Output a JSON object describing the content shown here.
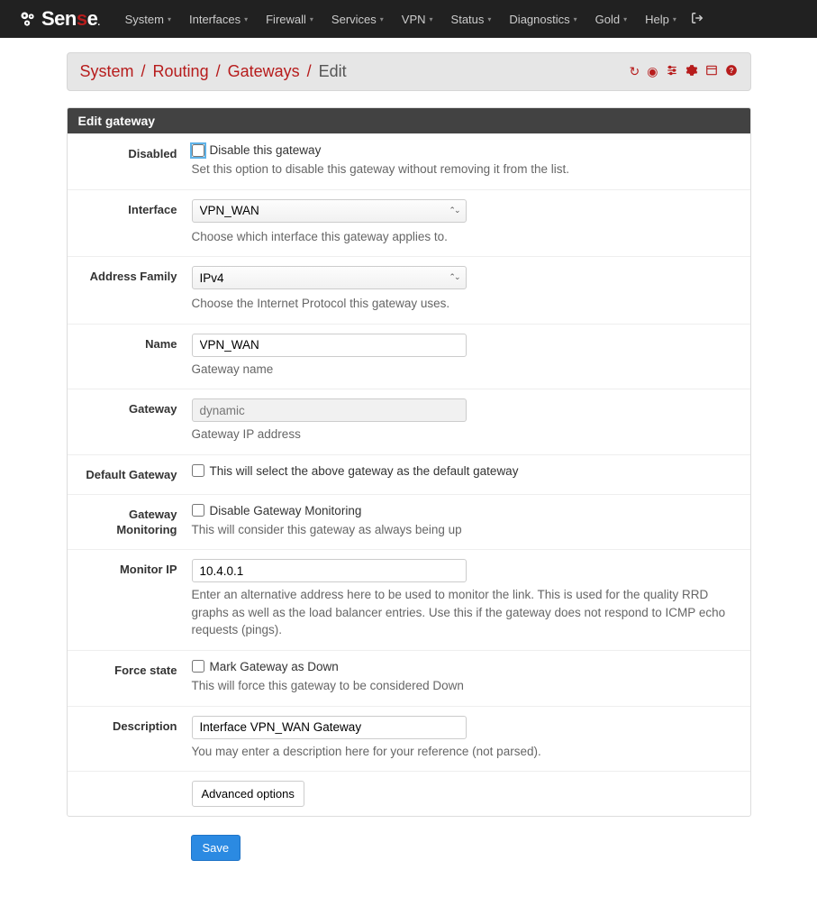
{
  "logo": {
    "text_sen": "Sen",
    "text_s": "s",
    "text_e": "e",
    "dot": "."
  },
  "nav": {
    "items": [
      "System",
      "Interfaces",
      "Firewall",
      "Services",
      "VPN",
      "Status",
      "Diagnostics",
      "Gold",
      "Help"
    ]
  },
  "breadcrumb": {
    "parts": [
      "System",
      "Routing",
      "Gateways"
    ],
    "current": "Edit"
  },
  "panel_title": "Edit gateway",
  "fields": {
    "disabled": {
      "label": "Disabled",
      "checkbox_label": "Disable this gateway",
      "help": "Set this option to disable this gateway without removing it from the list."
    },
    "interface": {
      "label": "Interface",
      "value": "VPN_WAN",
      "help": "Choose which interface this gateway applies to."
    },
    "address_family": {
      "label": "Address Family",
      "value": "IPv4",
      "help": "Choose the Internet Protocol this gateway uses."
    },
    "name": {
      "label": "Name",
      "value": "VPN_WAN",
      "help": "Gateway name"
    },
    "gateway": {
      "label": "Gateway",
      "value": "dynamic",
      "help": "Gateway IP address"
    },
    "default_gateway": {
      "label": "Default Gateway",
      "checkbox_label": "This will select the above gateway as the default gateway"
    },
    "gateway_monitoring": {
      "label": "Gateway Monitoring",
      "checkbox_label": "Disable Gateway Monitoring",
      "help": "This will consider this gateway as always being up"
    },
    "monitor_ip": {
      "label": "Monitor IP",
      "value": "10.4.0.1",
      "help": "Enter an alternative address here to be used to monitor the link. This is used for the quality RRD graphs as well as the load balancer entries. Use this if the gateway does not respond to ICMP echo requests (pings)."
    },
    "force_state": {
      "label": "Force state",
      "checkbox_label": "Mark Gateway as Down",
      "help": "This will force this gateway to be considered Down"
    },
    "description": {
      "label": "Description",
      "value": "Interface VPN_WAN Gateway",
      "help": "You may enter a description here for your reference (not parsed)."
    }
  },
  "buttons": {
    "advanced": "Advanced options",
    "save": "Save"
  }
}
